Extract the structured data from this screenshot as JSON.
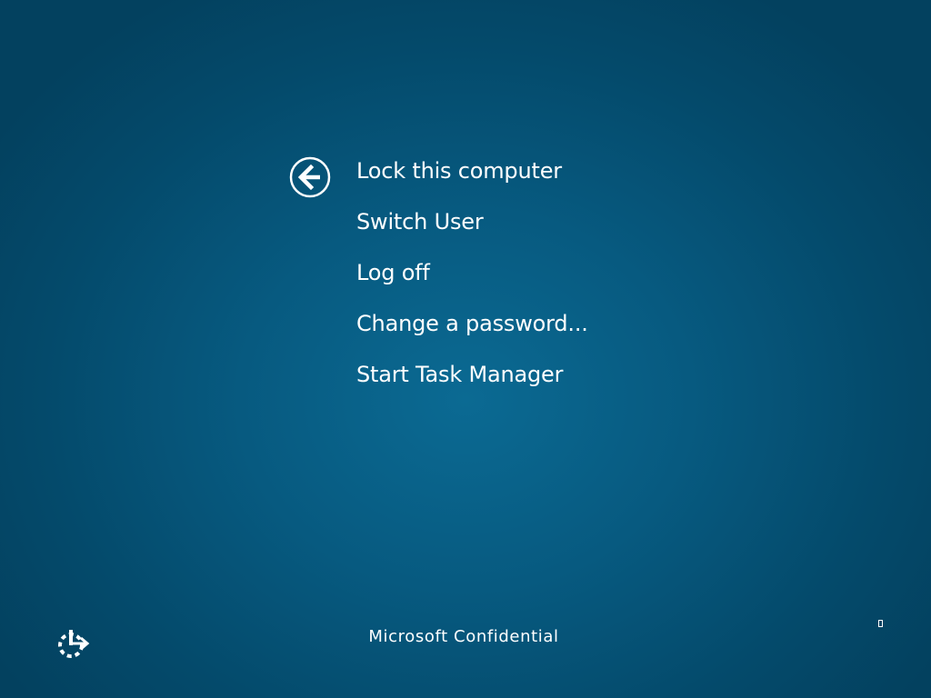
{
  "back": {
    "icon": "back-arrow-icon"
  },
  "menu": {
    "items": [
      {
        "label": "Lock this computer"
      },
      {
        "label": "Switch User"
      },
      {
        "label": "Log off"
      },
      {
        "label": "Change a password..."
      },
      {
        "label": "Start Task Manager"
      }
    ]
  },
  "ease_of_access": {
    "icon": "ease-of-access-icon"
  },
  "footer": {
    "text": "Microsoft Confidential"
  },
  "colors": {
    "background_center": "#0b6a93",
    "background_edge": "#03415f",
    "text": "#ffffff"
  }
}
